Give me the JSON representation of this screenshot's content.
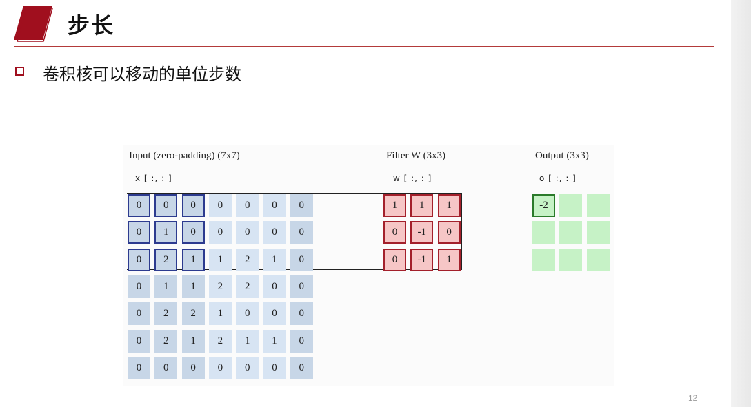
{
  "slide": {
    "title": "步长",
    "bullet": "卷积核可以移动的单位步数",
    "page_number": "12"
  },
  "colors": {
    "brand": "#a00f1e",
    "input_cell": "#c7d6e7",
    "input_cell_highlight_border": "#2d3b8f",
    "filter_cell": "#f6c6c6",
    "filter_border": "#a3202b",
    "output_cell": "#c6f2c6",
    "output_highlight_border": "#2a7a2a"
  },
  "figure": {
    "input": {
      "label": "Input (zero-padding) (7x7)",
      "sublabel": "x [ :, : ]",
      "grid": [
        [
          "0",
          "0",
          "0",
          "0",
          "0",
          "0",
          "0"
        ],
        [
          "0",
          "1",
          "0",
          "0",
          "0",
          "0",
          "0"
        ],
        [
          "0",
          "2",
          "1",
          "1",
          "2",
          "1",
          "0"
        ],
        [
          "0",
          "1",
          "1",
          "2",
          "2",
          "0",
          "0"
        ],
        [
          "0",
          "2",
          "2",
          "1",
          "0",
          "0",
          "0"
        ],
        [
          "0",
          "2",
          "1",
          "2",
          "1",
          "1",
          "0"
        ],
        [
          "0",
          "0",
          "0",
          "0",
          "0",
          "0",
          "0"
        ]
      ]
    },
    "filter": {
      "label": "Filter W (3x3)",
      "sublabel": "w [ :, : ]",
      "grid": [
        [
          "1",
          "1",
          "1"
        ],
        [
          "0",
          "-1",
          "0"
        ],
        [
          "0",
          "-1",
          "1"
        ]
      ]
    },
    "output": {
      "label": "Output (3x3)",
      "sublabel": "o [ :, : ]",
      "grid": [
        [
          "-2",
          "",
          ""
        ],
        [
          "",
          "",
          ""
        ],
        [
          "",
          "",
          ""
        ]
      ]
    }
  }
}
